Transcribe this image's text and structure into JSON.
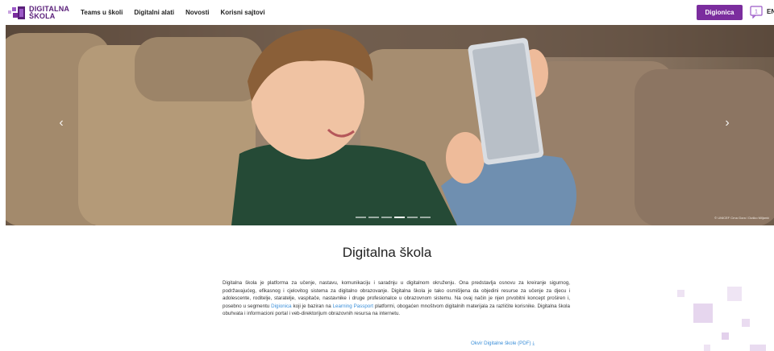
{
  "header": {
    "logo": {
      "line1": "DIGITALNA",
      "line2": "ŠKOLA"
    },
    "nav": [
      "Teams u školi",
      "Digitalni alati",
      "Novosti",
      "Korisni sajtovi"
    ],
    "cta_label": "Digionica",
    "notification_count": "1",
    "lang_label": "EN"
  },
  "hero": {
    "prev_arrow": "‹",
    "next_arrow": "›",
    "credit": "© UNICEF Crna Gora / Duško Miljanić",
    "slides_count": 6,
    "active_slide": 3
  },
  "main": {
    "title": "Digitalna škola",
    "desc_part1": "Digitalna škola je platforma za učenje, nastavu, komunikaciju i saradnju u digitalnom okruženju. Ona predstavlja osnovu za kreiranje sigurnog, podržavajućeg, efikasnog i cjelovitog sistema za digitalno obrazovanje. Digitalna škola je tako osmišljena da objedini resurse za učenje za djecu i adolescente, roditelje, staratelje, vaspitače, nastavnike i druge profesionalce u obrazovnom sistemu. Na ovaj način je njen prvobitni koncept proširen i, posebno u segmentu ",
    "desc_link1": "Digionica",
    "desc_part2": " koji je baziran na ",
    "desc_link2": "Learning Passport",
    "desc_part3": " platformi, obogaćen mnoštvom digitalnih materijala za različite korisnike. Digitalna škola obuhvata i informacioni portal i veb-direktorijum obrazovnih resursa na internetu.",
    "pdf_link": "Okvir Digitalne škole (PDF)",
    "pdf_icon": "⤓"
  },
  "colors": {
    "brand_purple": "#7b2d9e",
    "link_blue": "#3b8fd9",
    "deco_lilac": "#e6d6ee"
  }
}
